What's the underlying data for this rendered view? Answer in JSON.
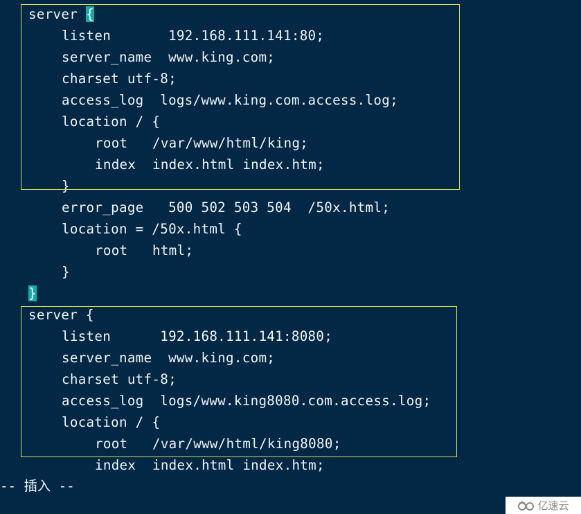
{
  "editor": {
    "lines": [
      {
        "indent": 0,
        "pre": "server ",
        "cursor": "{",
        "post": ""
      },
      {
        "indent": 1,
        "text": "listen       192.168.111.141:80;"
      },
      {
        "indent": 1,
        "text": "server_name  www.king.com;"
      },
      {
        "indent": 1,
        "text": "charset utf-8;"
      },
      {
        "indent": 1,
        "text": "access_log  logs/www.king.com.access.log;"
      },
      {
        "indent": 1,
        "text": "location / {"
      },
      {
        "indent": 2,
        "text": "root   /var/www/html/king;"
      },
      {
        "indent": 2,
        "text": "index  index.html index.htm;"
      },
      {
        "indent": 1,
        "text": "}"
      },
      {
        "indent": 1,
        "text": "error_page   500 502 503 504  /50x.html;"
      },
      {
        "indent": 1,
        "text": "location = /50x.html {"
      },
      {
        "indent": 2,
        "text": "root   html;"
      },
      {
        "indent": 1,
        "text": "}"
      },
      {
        "indent": 0,
        "pre": "",
        "cursor": "}",
        "post": ""
      },
      {
        "indent": 0,
        "text": "server {"
      },
      {
        "indent": 1,
        "text": "listen      192.168.111.141:8080;"
      },
      {
        "indent": 1,
        "text": "server_name  www.king.com;"
      },
      {
        "indent": 1,
        "text": "charset utf-8;"
      },
      {
        "indent": 1,
        "text": "access_log  logs/www.king8080.com.access.log;"
      },
      {
        "indent": 1,
        "text": "location / {"
      },
      {
        "indent": 2,
        "text": "root   /var/www/html/king8080;"
      },
      {
        "indent": 2,
        "text": "index  index.html index.htm;"
      }
    ],
    "mode_status": "-- 插入 --",
    "colors": {
      "background": "#022846",
      "text": "#f2f4f6",
      "bracket_match": "#1aa9a9",
      "highlight_box": "#d8df5a"
    }
  },
  "watermark": {
    "icon": "yisu-cloud-logo-icon",
    "text": "亿速云"
  }
}
